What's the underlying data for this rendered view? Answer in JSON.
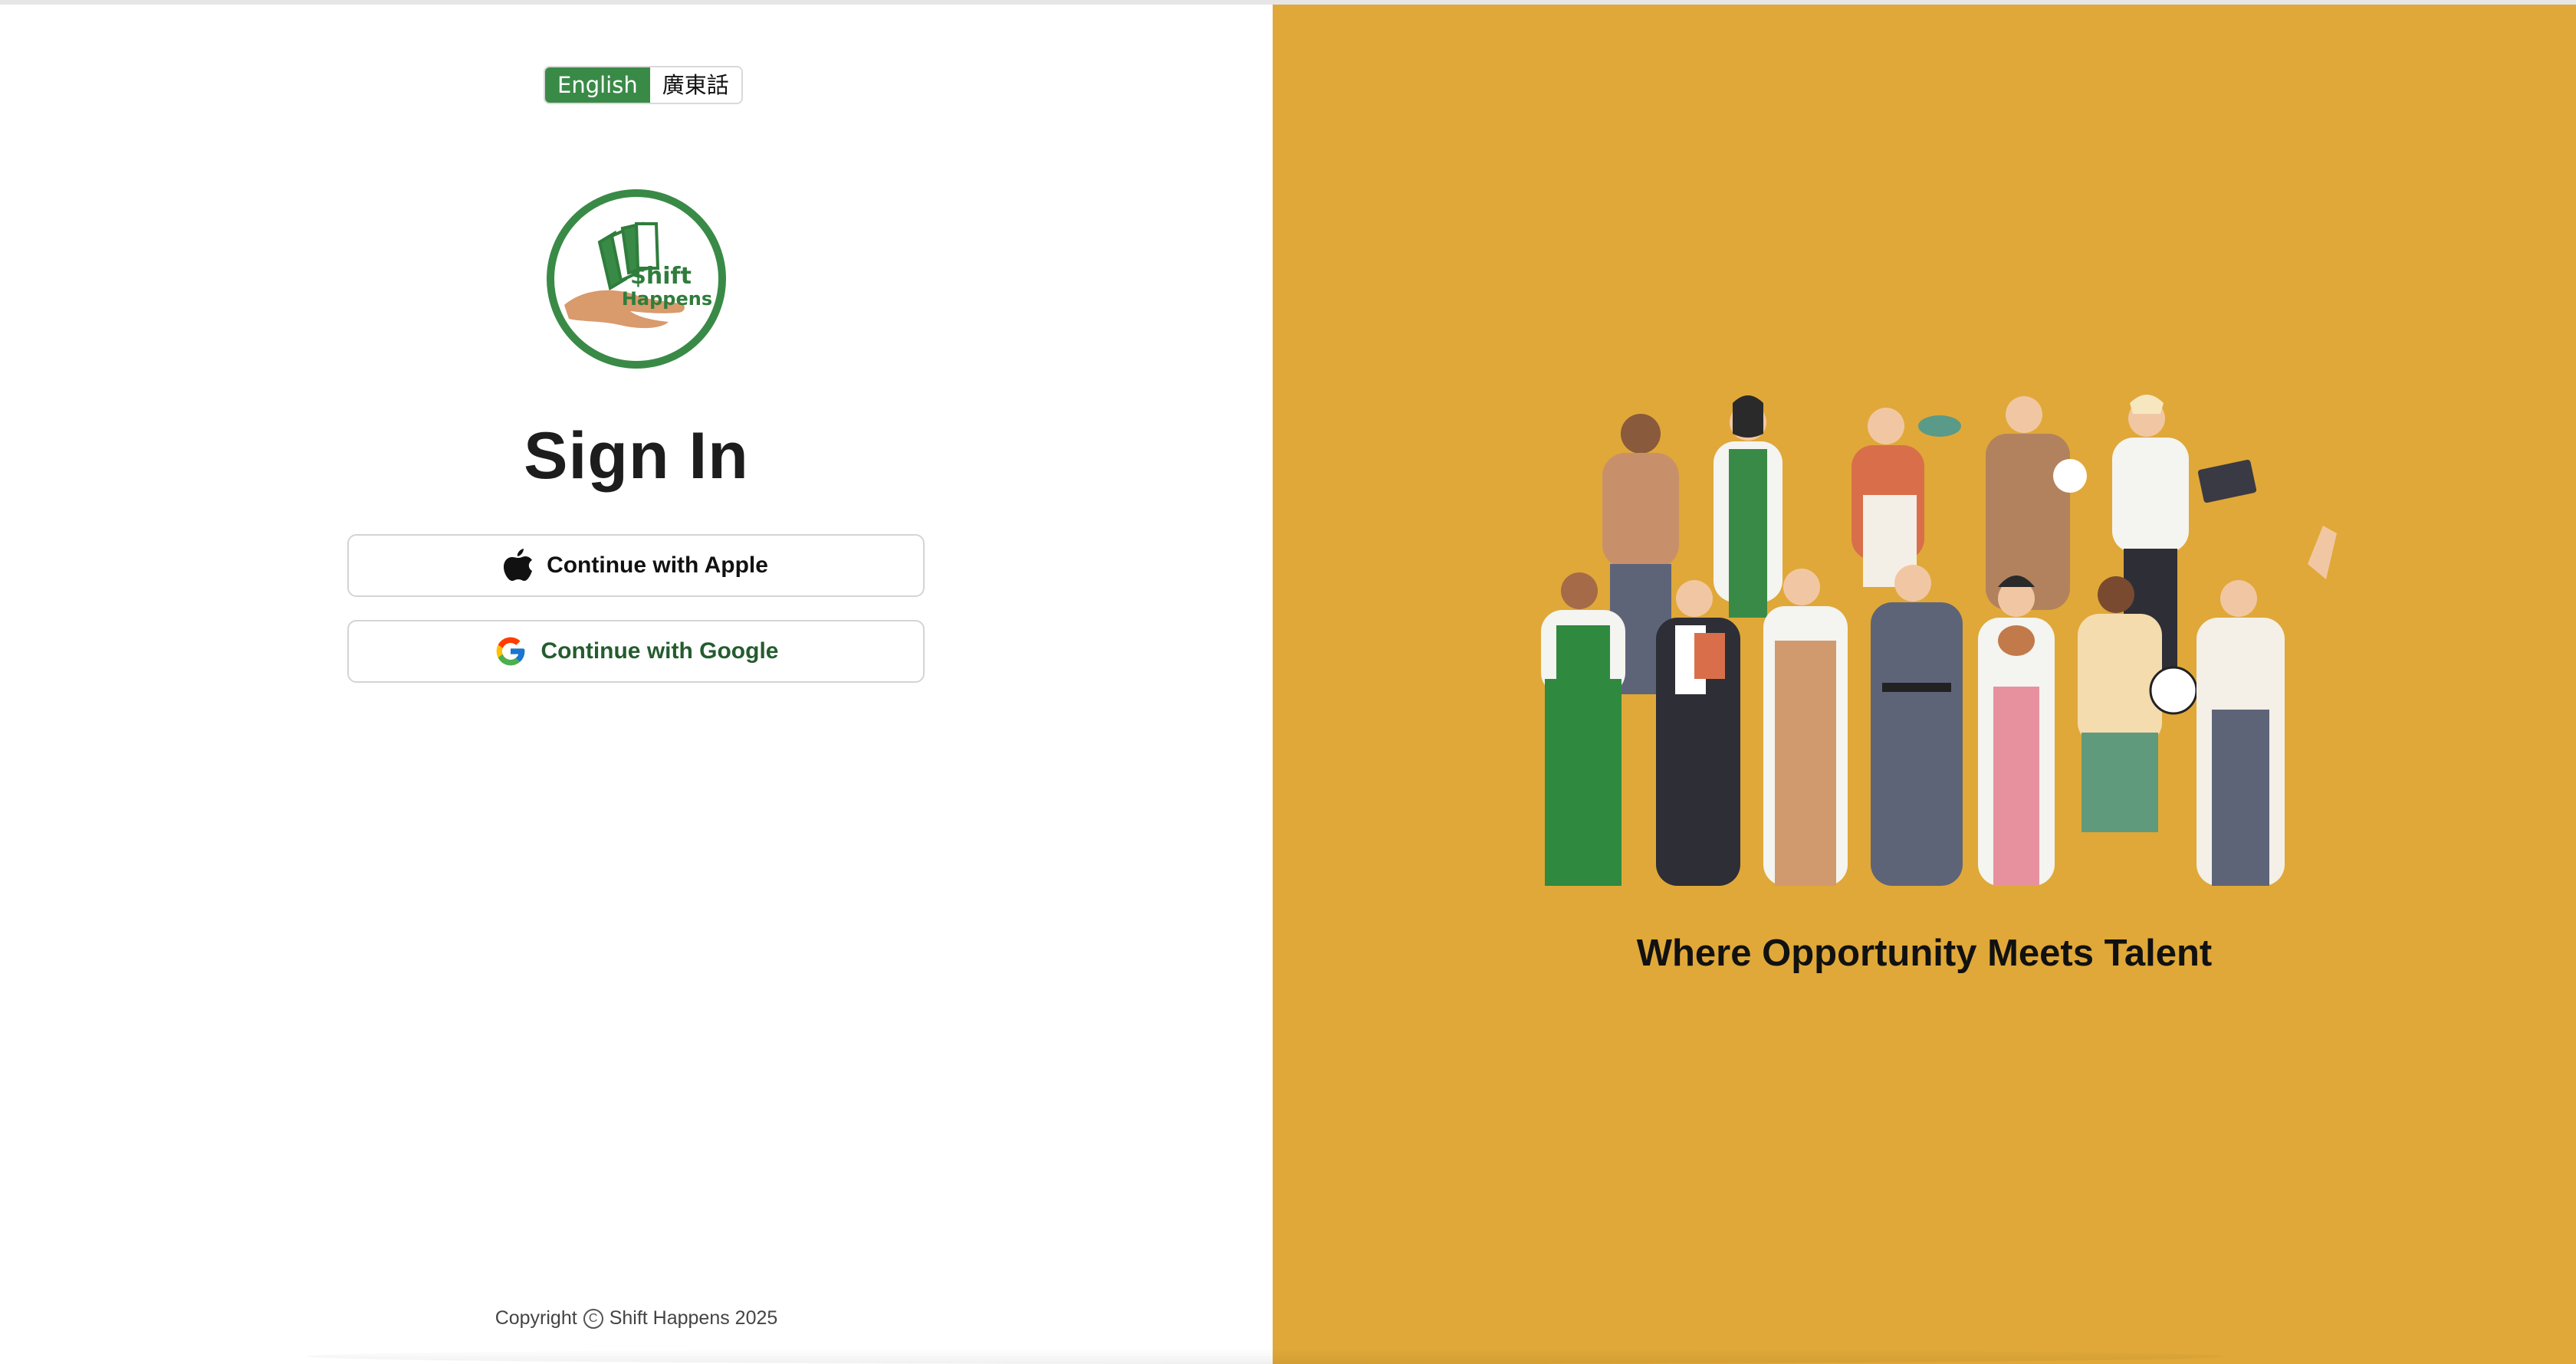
{
  "language_switch": {
    "english_label": "English",
    "cantonese_label": "廣東話",
    "active": "English"
  },
  "logo": {
    "line1": "$hift",
    "line2": "Happens",
    "ring_color": "#3a8a47"
  },
  "signin": {
    "title": "Sign In",
    "apple_label": "Continue with Apple",
    "google_label": "Continue with Google"
  },
  "footer": {
    "copyright_prefix": "Copyright",
    "copyright_icon": "copyright-icon",
    "copyright_holder": "Shift Happens 2025"
  },
  "promo": {
    "tagline": "Where Opportunity Meets Talent",
    "background_color": "#e0a838",
    "illustration": "diverse-workers-group-illustration"
  },
  "colors": {
    "brand_green": "#3a8a47",
    "google_text": "#245c2e"
  }
}
